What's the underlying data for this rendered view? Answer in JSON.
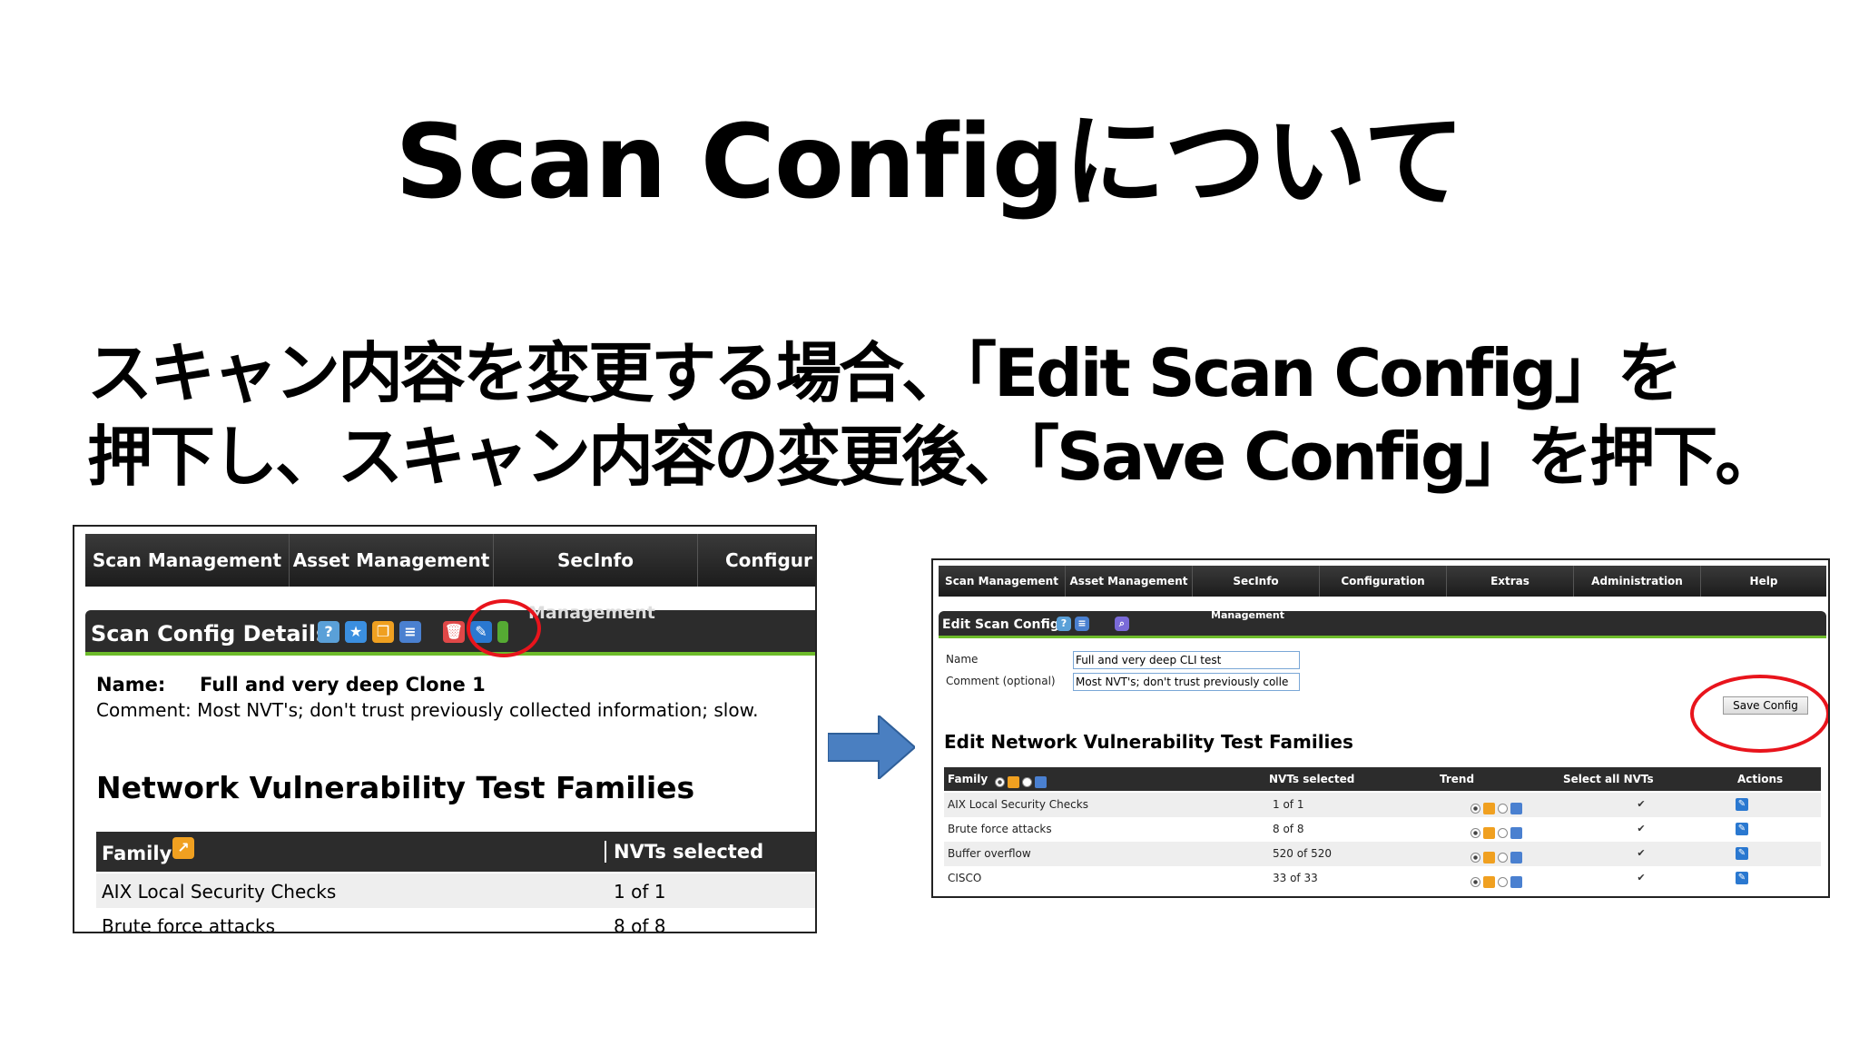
{
  "slide": {
    "title": "Scan Configについて",
    "line1": "スキャン内容を変更する場合、「Edit Scan Config」を",
    "line2": "押下し、スキャン内容の変更後、「Save Config」を押下。"
  },
  "left_screenshot": {
    "nav": [
      "Scan Management",
      "Asset Management",
      "SecInfo",
      "Configur"
    ],
    "nav_sub": "Management",
    "section_title": "Scan Config Details",
    "icons": [
      "help-icon",
      "new-icon",
      "clone-icon",
      "list-icon",
      "trash-icon",
      "edit-icon",
      "export-icon"
    ],
    "name_label": "Name:",
    "name_value": "Full and very deep Clone 1",
    "comment_label": "Comment:",
    "comment_value": "Most NVT's; don't trust previously collected information; slow.",
    "heading": "Network Vulnerability Test Families",
    "columns": [
      "Family",
      "NVTs selected"
    ],
    "rows": [
      {
        "family": "AIX Local Security Checks",
        "nvts": "1 of 1"
      },
      {
        "family": "Brute force attacks",
        "nvts": "8 of 8"
      }
    ]
  },
  "right_screenshot": {
    "nav": [
      "Scan Management",
      "Asset Management",
      "SecInfo",
      "Configuration",
      "Extras",
      "Administration",
      "Help"
    ],
    "nav_sub": "Management",
    "section_title": "Edit Scan Config",
    "name_label": "Name",
    "name_value": "Full and very deep CLI test",
    "comment_label": "Comment (optional)",
    "comment_value": "Most NVT's; don't trust previously colle",
    "save_button": "Save Config",
    "heading": "Edit Network Vulnerability Test Families",
    "columns": [
      "Family",
      "NVTs selected",
      "Trend",
      "Select all NVTs",
      "Actions"
    ],
    "rows": [
      {
        "family": "AIX Local Security Checks",
        "nvts": "1 of 1"
      },
      {
        "family": "Brute force attacks",
        "nvts": "8 of 8"
      },
      {
        "family": "Buffer overflow",
        "nvts": "520 of 520"
      },
      {
        "family": "CISCO",
        "nvts": "33 of 33"
      }
    ]
  },
  "colors": {
    "highlight_circle": "#e8141c",
    "arrow": "#4a7fc1",
    "accent_green": "#6dbb2a",
    "header_dark": "#2c2c2c"
  }
}
